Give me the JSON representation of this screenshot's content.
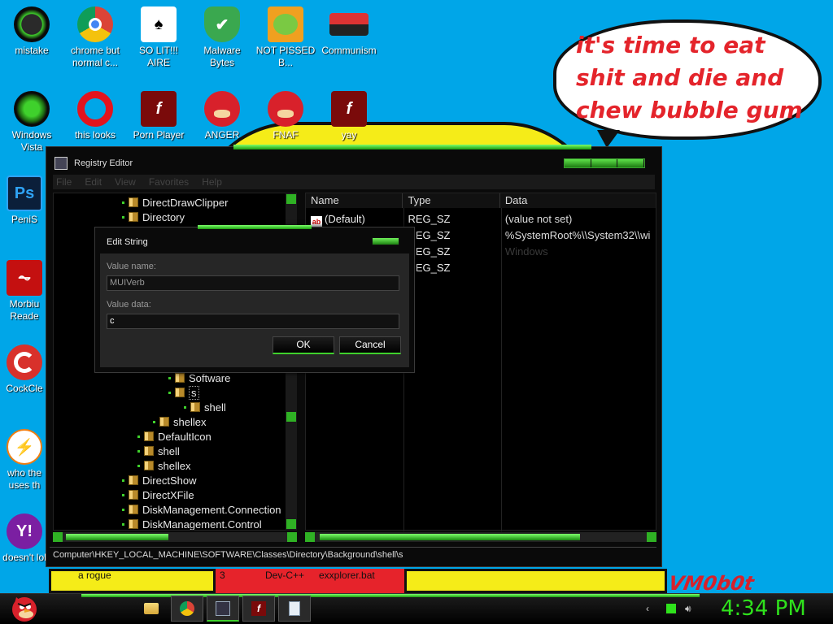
{
  "desktop": {
    "icons": [
      {
        "label": "mistake",
        "icon": "green-orb-icon"
      },
      {
        "label": "chrome but normal c...",
        "icon": "chrome-icon"
      },
      {
        "label": "SO LIT!!! AIRE",
        "icon": "playing-cards-icon"
      },
      {
        "label": "Malware Bytes",
        "icon": "shield-check-icon"
      },
      {
        "label": "NOT PISSED B...",
        "icon": "angry-pig-icon"
      },
      {
        "label": "Communism",
        "icon": "emblem-icon"
      },
      {
        "label": "Windows Vista",
        "icon": "recycle-orb-icon"
      },
      {
        "label": "this looks",
        "icon": "opera-icon"
      },
      {
        "label": "Porn Player",
        "icon": "flash-icon"
      },
      {
        "label": "ANGER",
        "icon": "angry-bird-icon"
      },
      {
        "label": "FNAF",
        "icon": "angry-bird-icon"
      },
      {
        "label": "yay",
        "icon": "flash-icon"
      },
      {
        "label": "PeniS",
        "icon": "photoshop-icon"
      },
      {
        "label": "Morbiu Reade",
        "icon": "acrobat-icon"
      },
      {
        "label": "CockCle",
        "icon": "ccleaner-icon"
      },
      {
        "label": "who the uses th",
        "icon": "lightning-icon"
      },
      {
        "label": "doesn't lol",
        "icon": "yahoo-messenger-icon"
      }
    ]
  },
  "wallpaper": {
    "bubble_text": "it's time to eat shit and die and chew bubble gum",
    "signature": "VM0b0t",
    "bottom_labels": [
      "a rogue",
      "3",
      "Dev-C++",
      "exxplorer.bat"
    ],
    "accent": "#3fd12c"
  },
  "registry": {
    "title": "Registry Editor",
    "menu": [
      "File",
      "Edit",
      "View",
      "Favorites",
      "Help"
    ],
    "tree": [
      {
        "label": "DirectDrawClipper"
      },
      {
        "label": "Directory"
      },
      {
        "label": "Software"
      },
      {
        "label": "s"
      },
      {
        "label": "shell"
      },
      {
        "label": "shellex"
      },
      {
        "label": "DefaultIcon"
      },
      {
        "label": "shell"
      },
      {
        "label": "shellex"
      },
      {
        "label": "DirectShow"
      },
      {
        "label": "DirectXFile"
      },
      {
        "label": "DiskManagement.Connection"
      },
      {
        "label": "DiskManagement.Control"
      }
    ],
    "columns": [
      "Name",
      "Type",
      "Data"
    ],
    "rows": [
      {
        "name": "(Default)",
        "type": "REG_SZ",
        "data": "(value not set)"
      },
      {
        "name": "",
        "type": "REG_SZ",
        "data": "%SystemRoot%\\\\System32\\\\wi"
      },
      {
        "name": "",
        "type": "REG_SZ",
        "data": "Windows"
      },
      {
        "name": "",
        "type": "REG_SZ",
        "data": ""
      }
    ],
    "status_path": "Computer\\HKEY_LOCAL_MACHINE\\SOFTWARE\\Classes\\Directory\\Background\\shell\\s"
  },
  "dialog": {
    "title": "Edit String",
    "value_name_label": "Value name:",
    "value_name": "MUIVerb",
    "value_data_label": "Value data:",
    "value_data": "c",
    "ok_label": "OK",
    "cancel_label": "Cancel"
  },
  "taskbar": {
    "items": [
      "folder-icon",
      "chrome-icon",
      "regedit-icon",
      "flash-icon",
      "notepad-icon"
    ],
    "clock": "4:34 PM"
  }
}
